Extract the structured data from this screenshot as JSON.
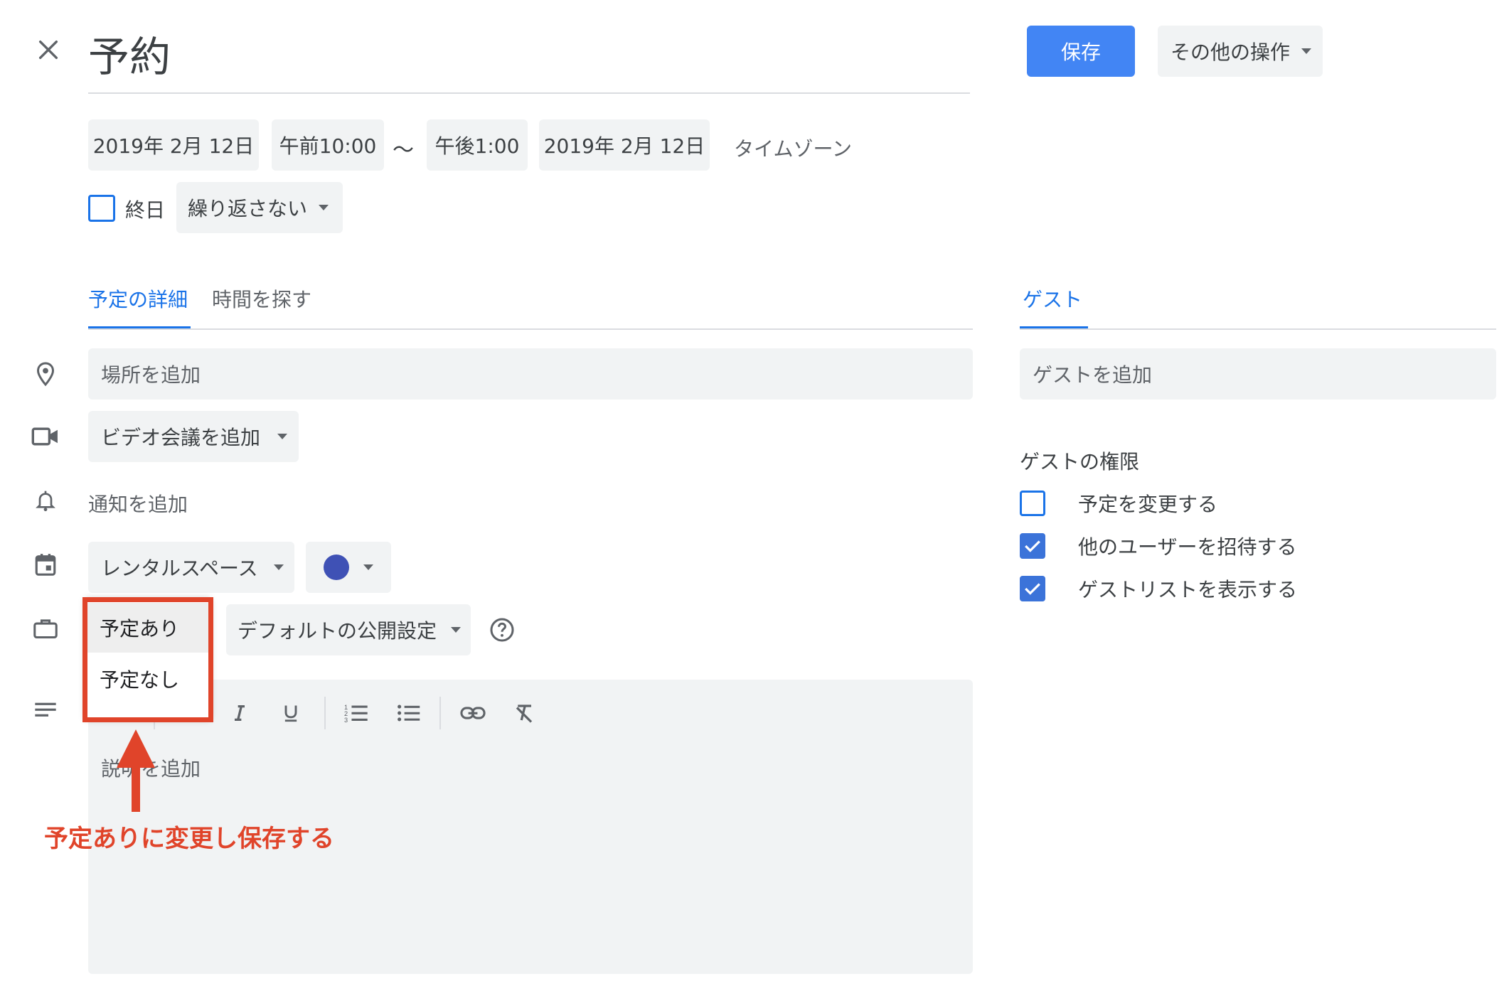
{
  "header": {
    "title": "予約",
    "save_label": "保存",
    "more_actions_label": "その他の操作"
  },
  "datetime": {
    "start_date": "2019年 2月 12日",
    "start_time": "午前10:00",
    "separator": "〜",
    "end_time": "午後1:00",
    "end_date": "2019年 2月 12日",
    "timezone_label": "タイムゾーン",
    "all_day_label": "終日",
    "repeat_label": "繰り返さない"
  },
  "tabs": {
    "details": "予定の詳細",
    "find_time": "時間を探す",
    "guests": "ゲスト"
  },
  "details": {
    "location_placeholder": "場所を追加",
    "video_label": "ビデオ会議を追加",
    "notification_label": "通知を追加",
    "calendar_label": "レンタルスペース",
    "event_color": "#3f51b5",
    "visibility_label": "デフォルトの公開設定",
    "description_placeholder": "説明を追加"
  },
  "availability_menu": {
    "options": [
      "予定あり",
      "予定なし"
    ],
    "selected": "予定あり"
  },
  "annotation": {
    "text": "予定ありに変更し保存する",
    "color": "#e0442a"
  },
  "guests": {
    "add_placeholder": "ゲストを追加",
    "permissions_title": "ゲストの権限",
    "permissions": [
      {
        "label": "予定を変更する",
        "checked": false
      },
      {
        "label": "他のユーザーを招待する",
        "checked": true
      },
      {
        "label": "ゲストリストを表示する",
        "checked": true
      }
    ]
  },
  "colors": {
    "accent": "#1a73e8",
    "primary_button": "#4285f4"
  }
}
